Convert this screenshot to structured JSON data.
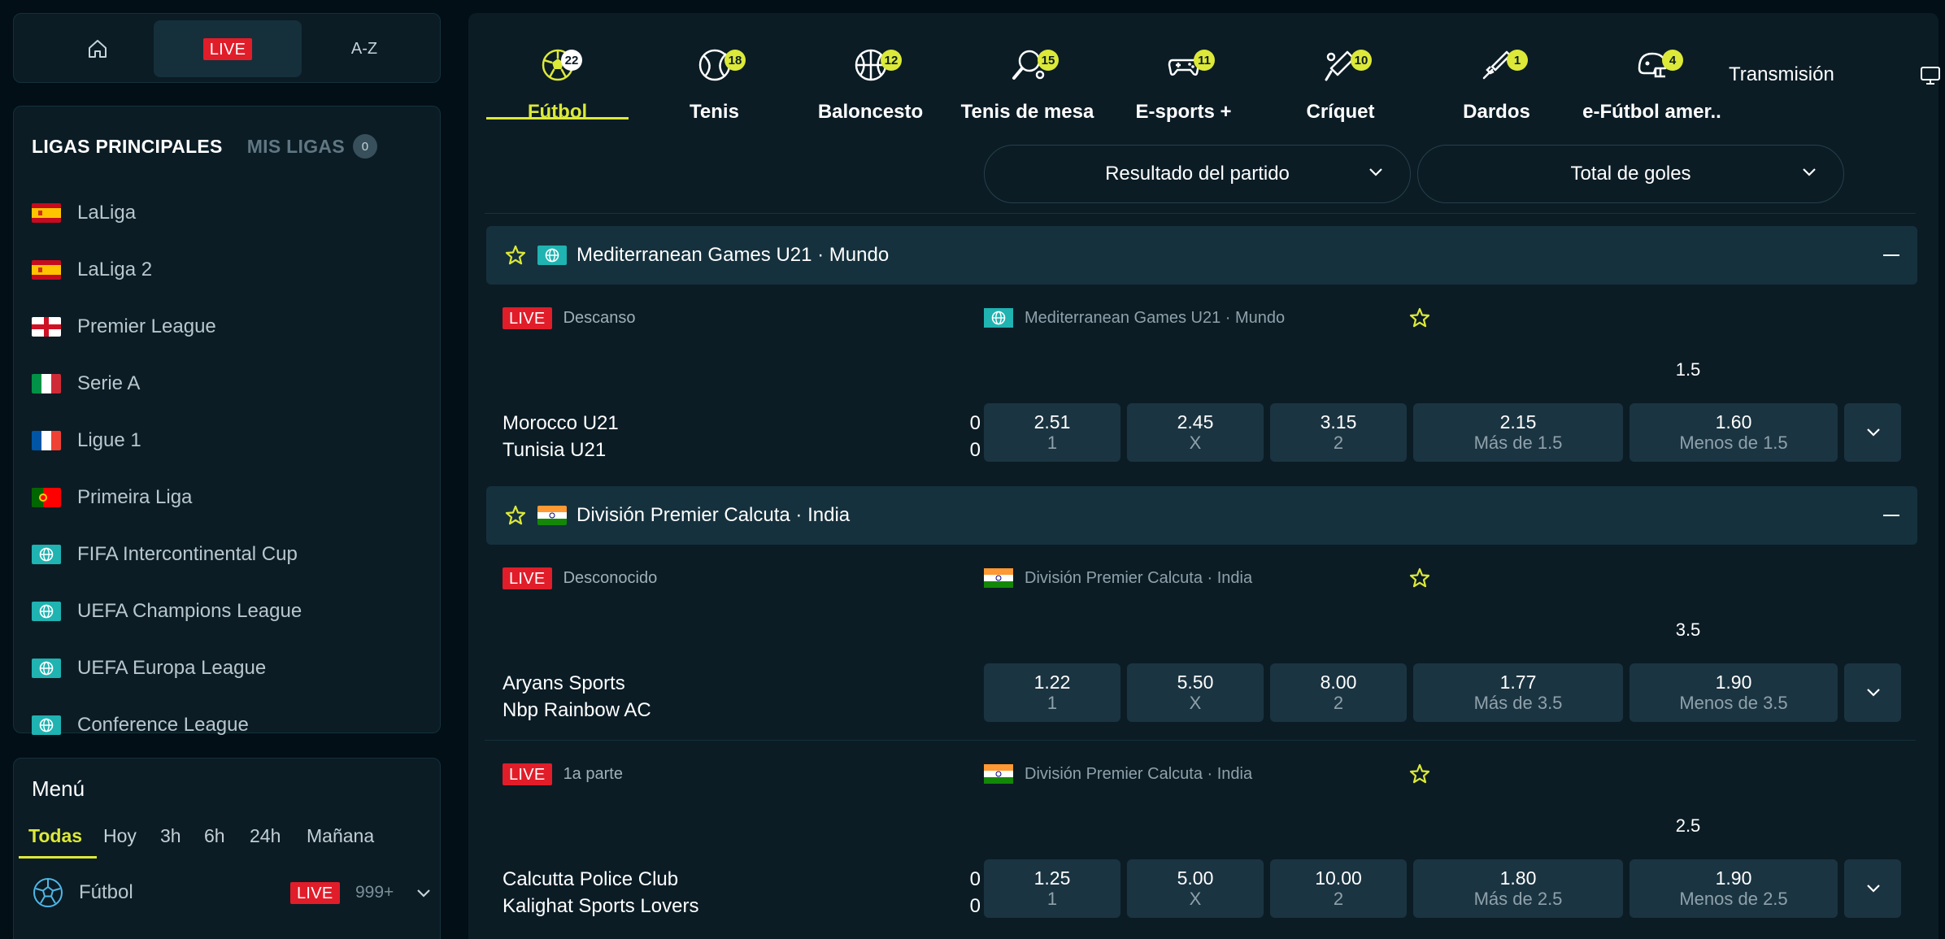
{
  "topnav": {
    "live_label": "LIVE",
    "az_label": "A-Z"
  },
  "leagues": {
    "title": "LIGAS PRINCIPALES",
    "my_leagues_label": "MIS LIGAS",
    "my_leagues_count": "0",
    "items": [
      {
        "name": "LaLiga",
        "flag": "es"
      },
      {
        "name": "LaLiga 2",
        "flag": "es"
      },
      {
        "name": "Premier League",
        "flag": "en"
      },
      {
        "name": "Serie A",
        "flag": "it"
      },
      {
        "name": "Ligue 1",
        "flag": "fr"
      },
      {
        "name": "Primeira Liga",
        "flag": "pt"
      },
      {
        "name": "FIFA Intercontinental Cup",
        "flag": "world"
      },
      {
        "name": "UEFA Champions League",
        "flag": "world"
      },
      {
        "name": "UEFA Europa League",
        "flag": "world"
      },
      {
        "name": "Conference League",
        "flag": "world"
      }
    ]
  },
  "menu": {
    "title": "Menú",
    "filters": [
      "Todas",
      "Hoy",
      "3h",
      "6h",
      "24h",
      "Mañana"
    ],
    "sport": {
      "name": "Fútbol",
      "live_label": "LIVE",
      "count": "999+"
    }
  },
  "sports_tabs": [
    {
      "label": "Fútbol",
      "count": "22",
      "icon": "soccer-ball-icon"
    },
    {
      "label": "Tenis",
      "count": "18",
      "icon": "tennis-ball-icon"
    },
    {
      "label": "Baloncesto",
      "count": "12",
      "icon": "basketball-icon"
    },
    {
      "label": "Tenis de mesa",
      "count": "15",
      "icon": "table-tennis-icon"
    },
    {
      "label": "E-sports +",
      "count": "11",
      "icon": "gamepad-icon"
    },
    {
      "label": "Críquet",
      "count": "10",
      "icon": "cricket-bat-icon"
    },
    {
      "label": "Dardos",
      "count": "1",
      "icon": "dart-icon"
    },
    {
      "label": "e-Fútbol amer..",
      "count": "4",
      "icon": "american-football-helmet-icon"
    }
  ],
  "transmision": {
    "label": "Transmisión"
  },
  "markets": {
    "result": "Resultado del partido",
    "total": "Total de goles"
  },
  "competitions": [
    {
      "title": "Mediterranean Games U21 · Mundo",
      "flag": "world"
    },
    {
      "title": "División Premier Calcuta · India",
      "flag": "in"
    }
  ],
  "events": [
    {
      "live": "LIVE",
      "status": "Descanso",
      "competition": "Mediterranean Games U21 · Mundo",
      "flag": "world",
      "home": "Morocco U21",
      "away": "Tunisia U21",
      "home_score": "0",
      "away_score": "0",
      "line": "1.5",
      "odds": [
        {
          "value": "2.51",
          "label": "1"
        },
        {
          "value": "2.45",
          "label": "X"
        },
        {
          "value": "3.15",
          "label": "2"
        },
        {
          "value": "2.15",
          "label": "Más de 1.5"
        },
        {
          "value": "1.60",
          "label": "Menos de 1.5"
        }
      ]
    },
    {
      "live": "LIVE",
      "status": "Desconocido",
      "competition": "División Premier Calcuta · India",
      "flag": "in",
      "home": "Aryans Sports",
      "away": "Nbp Rainbow AC",
      "home_score": "",
      "away_score": "",
      "line": "3.5",
      "odds": [
        {
          "value": "1.22",
          "label": "1"
        },
        {
          "value": "5.50",
          "label": "X"
        },
        {
          "value": "8.00",
          "label": "2"
        },
        {
          "value": "1.77",
          "label": "Más de 3.5"
        },
        {
          "value": "1.90",
          "label": "Menos de 3.5"
        }
      ]
    },
    {
      "live": "LIVE",
      "status": "1a parte",
      "competition": "División Premier Calcuta · India",
      "flag": "in",
      "home": "Calcutta Police Club",
      "away": "Kalighat Sports Lovers",
      "home_score": "0",
      "away_score": "0",
      "line": "2.5",
      "odds": [
        {
          "value": "1.25",
          "label": "1"
        },
        {
          "value": "5.00",
          "label": "X"
        },
        {
          "value": "10.00",
          "label": "2"
        },
        {
          "value": "1.80",
          "label": "Más de 2.5"
        },
        {
          "value": "1.90",
          "label": "Menos de 2.5"
        }
      ]
    }
  ],
  "colors": {
    "accent": "#dce938",
    "live": "#e11d2a",
    "panel": "#0b1c25",
    "background": "#020f17"
  }
}
